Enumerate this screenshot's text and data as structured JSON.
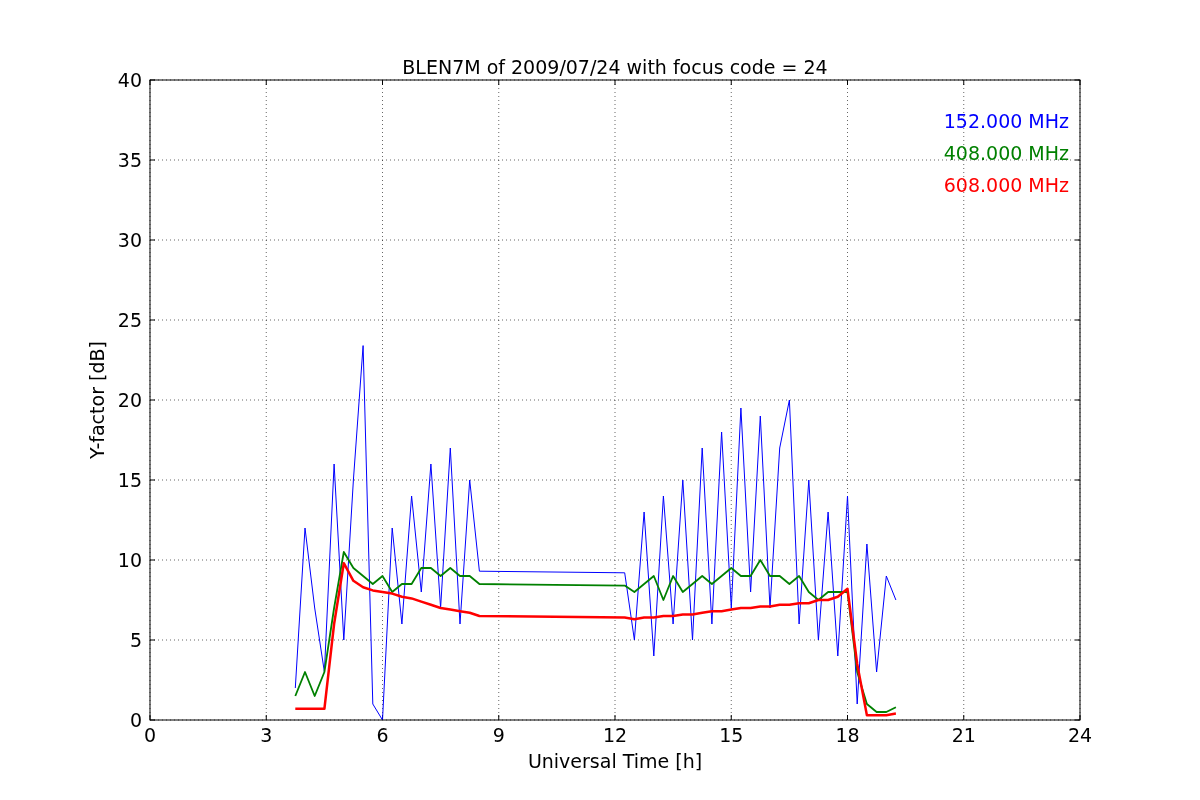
{
  "figure": {
    "chart_data": {
      "type": "line",
      "title": "BLEN7M of 2009/07/24 with focus code = 24",
      "xlabel": "Universal Time [h]",
      "ylabel": "Y-factor [dB]",
      "x": [
        3.75,
        4,
        4.25,
        4.5,
        4.75,
        5,
        5.25,
        5.5,
        5.75,
        6,
        6.25,
        6.5,
        6.75,
        7,
        7.25,
        7.5,
        7.75,
        8,
        8.25,
        8.5,
        12.25,
        12.5,
        12.75,
        13,
        13.25,
        13.5,
        13.75,
        14,
        14.25,
        14.5,
        14.75,
        15,
        15.25,
        15.5,
        15.75,
        16,
        16.25,
        16.5,
        16.75,
        17,
        17.25,
        17.5,
        17.75,
        18,
        18.25,
        18.5,
        18.75,
        19,
        19.25
      ],
      "series": [
        {
          "name": "152.000 MHz",
          "color": "#0000ff",
          "values": [
            2,
            12,
            7,
            3,
            16,
            5,
            15,
            23.4,
            1,
            0,
            12,
            6,
            14,
            8,
            16,
            7,
            17,
            6,
            15,
            9.3,
            9.2,
            5,
            13,
            4,
            14,
            6,
            15,
            5,
            17,
            6,
            18,
            7,
            19.5,
            8,
            19,
            7,
            17,
            20,
            6,
            15,
            5,
            13,
            4,
            14,
            1,
            11,
            3,
            9,
            7.5
          ]
        },
        {
          "name": "408.000 MHz",
          "color": "#008000",
          "values": [
            1.5,
            3,
            1.5,
            3,
            7,
            10.5,
            9.5,
            9,
            8.5,
            9,
            8,
            8.5,
            8.5,
            9.5,
            9.5,
            9,
            9.5,
            9,
            9,
            8.5,
            8.4,
            8,
            8.5,
            9,
            7.5,
            9,
            8,
            8.5,
            9,
            8.5,
            9,
            9.5,
            9,
            9,
            10,
            9,
            9,
            8.5,
            9,
            8,
            7.5,
            8,
            8,
            8,
            3,
            1,
            0.5,
            0.5,
            0.8
          ]
        },
        {
          "name": "608.000 MHz",
          "color": "#ff0000",
          "values": [
            0.7,
            0.7,
            0.7,
            0.7,
            6,
            9.8,
            8.7,
            8.3,
            8.1,
            8,
            7.9,
            7.7,
            7.6,
            7.4,
            7.2,
            7,
            6.9,
            6.8,
            6.7,
            6.5,
            6.4,
            6.3,
            6.4,
            6.4,
            6.5,
            6.5,
            6.6,
            6.6,
            6.7,
            6.8,
            6.8,
            6.9,
            7,
            7,
            7.1,
            7.1,
            7.2,
            7.2,
            7.3,
            7.3,
            7.5,
            7.5,
            7.7,
            8.2,
            3.5,
            0.3,
            0.3,
            0.3,
            0.4
          ]
        }
      ],
      "grid": true,
      "xlim": [
        0,
        24
      ],
      "ylim": [
        0,
        40
      ],
      "xticks": [
        0,
        3,
        6,
        9,
        12,
        15,
        18,
        21,
        24
      ],
      "yticks": [
        0,
        5,
        10,
        15,
        20,
        25,
        30,
        35,
        40
      ]
    }
  }
}
